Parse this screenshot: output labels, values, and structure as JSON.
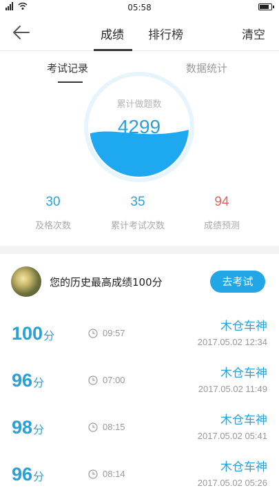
{
  "status_bar": {
    "time": "05:58",
    "signal": "ⅠlⅠ",
    "battery_level": 0.85
  },
  "header": {
    "tabs": [
      {
        "label": "成绩",
        "active": true
      },
      {
        "label": "排行榜",
        "active": false
      }
    ],
    "clear_label": "清空",
    "back_icon": "back-arrow-icon"
  },
  "subtabs": [
    {
      "label": "考试记录",
      "active": true
    },
    {
      "label": "数据统计",
      "active": false
    }
  ],
  "summary": {
    "caption": "累计做题数",
    "value": "4299",
    "fill_fraction": 0.45
  },
  "stats": [
    {
      "value": "30",
      "label": "及格次数"
    },
    {
      "value": "35",
      "label": "累计考试次数"
    },
    {
      "value": "94",
      "label": "成绩预测"
    }
  ],
  "best": {
    "text": "您的历史最高成绩100分",
    "button": "去考试"
  },
  "records": [
    {
      "score": "100",
      "unit": "分",
      "duration": "09:57",
      "name": "木仓车神",
      "date": "2017.05.02  12:34"
    },
    {
      "score": "96",
      "unit": "分",
      "duration": "07:00",
      "name": "木仓车神",
      "date": "2017.05.02  11:49"
    },
    {
      "score": "98",
      "unit": "分",
      "duration": "08:15",
      "name": "木仓车神",
      "date": "2017.05.02  05:41"
    },
    {
      "score": "96",
      "unit": "分",
      "duration": "08:14",
      "name": "木仓车神",
      "date": "2017.05.02  05:26"
    }
  ],
  "colors": {
    "accent": "#2aa0d8",
    "button": "#22a6e6",
    "prediction": "#e06461"
  }
}
